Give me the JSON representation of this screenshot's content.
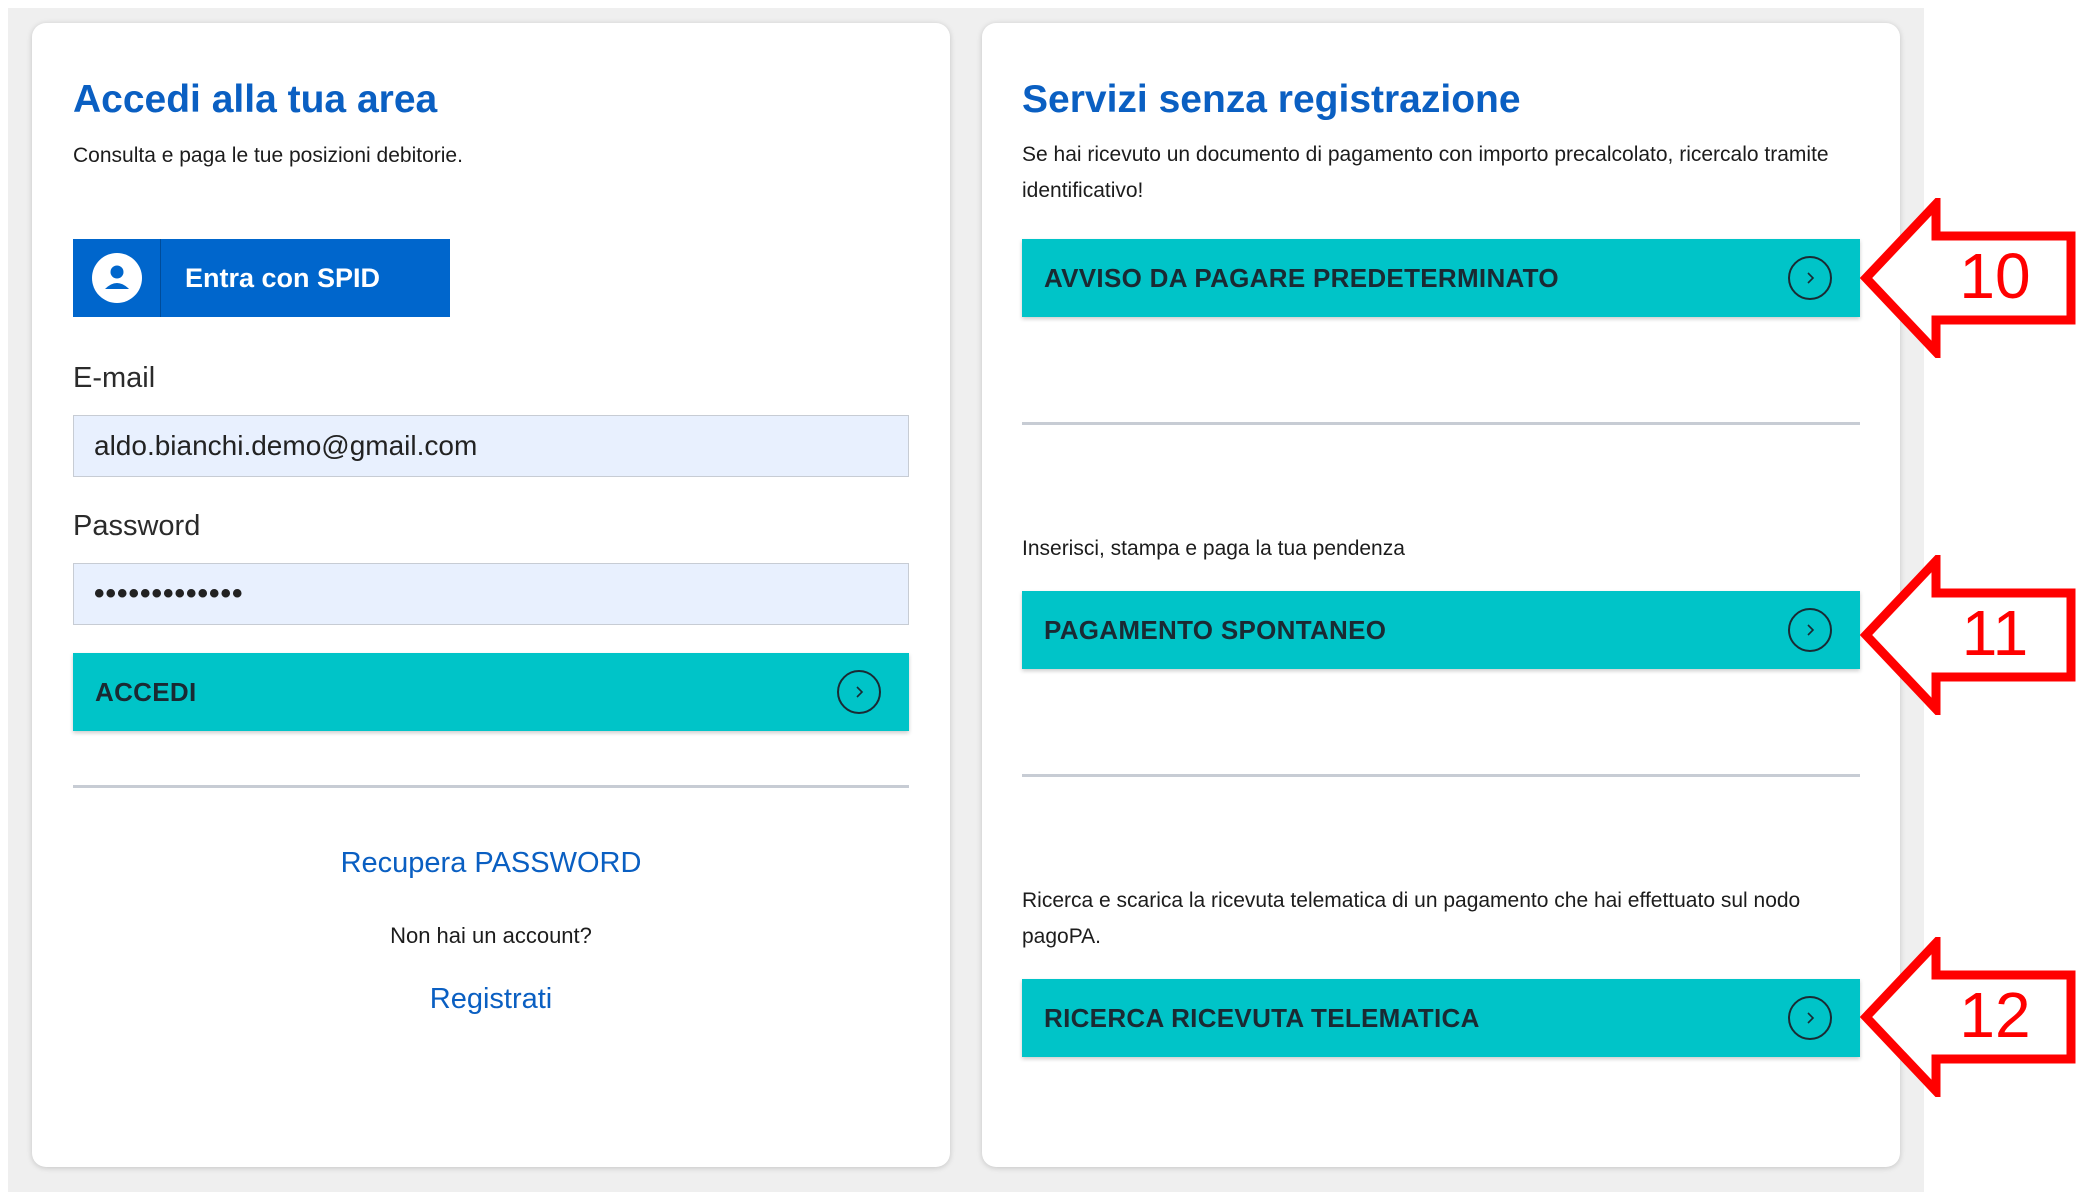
{
  "login": {
    "title": "Accedi alla tua area",
    "subtitle": "Consulta e paga le tue posizioni debitorie.",
    "spid_label": "Entra con SPID",
    "email_label": "E-mail",
    "email_value": "aldo.bianchi.demo@gmail.com",
    "password_label": "Password",
    "password_value": "•••••••••••••",
    "submit_label": "ACCEDI",
    "recover_link": "Recupera PASSWORD",
    "no_account_text": "Non hai un account?",
    "register_link": "Registrati"
  },
  "services": {
    "title": "Servizi senza registrazione",
    "items": [
      {
        "description": "Se hai ricevuto un documento di pagamento con importo precalcolato, ricercalo tramite identificativo!",
        "button_label": "AVVISO DA PAGARE PREDETERMINATO"
      },
      {
        "description": "Inserisci, stampa e paga la tua pendenza",
        "button_label": "PAGAMENTO SPONTANEO"
      },
      {
        "description": "Ricerca e scarica la ricevuta telematica di un pagamento che hai effettuato sul nodo pagoPA.",
        "button_label": "RICERCA RICEVUTA TELEMATICA"
      }
    ]
  },
  "callouts": [
    {
      "number": "10"
    },
    {
      "number": "11"
    },
    {
      "number": "12"
    }
  ],
  "colors": {
    "primary_blue": "#0066cc",
    "title_blue": "#0a5fc2",
    "teal": "#00c4c8",
    "callout_red": "#ff0000",
    "input_bg": "#e8f0fe"
  }
}
